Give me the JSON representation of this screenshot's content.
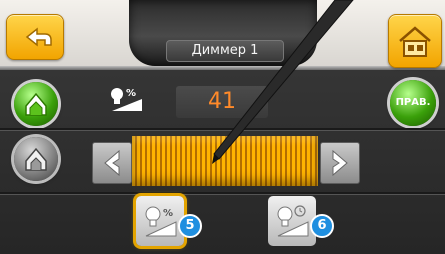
{
  "header": {
    "title": "Диммер 1"
  },
  "dimmer": {
    "value": "41",
    "level_percent": 100
  },
  "side": {
    "right_button_label": "ПРАВ."
  },
  "modes": {
    "badge_a": "5",
    "badge_b": "6"
  },
  "icons": {
    "back": "back-arrow-icon",
    "home": "home-icon",
    "scene_green": "house-icon",
    "scene_grey": "house-outline-icon",
    "level": "bulb-percent-icon",
    "mode_a": "bulb-percent-icon",
    "mode_b": "bulb-timer-icon"
  },
  "colors": {
    "accent": "#f2a400",
    "value_text": "#ff8a2a",
    "badge": "#1f8fe0"
  }
}
